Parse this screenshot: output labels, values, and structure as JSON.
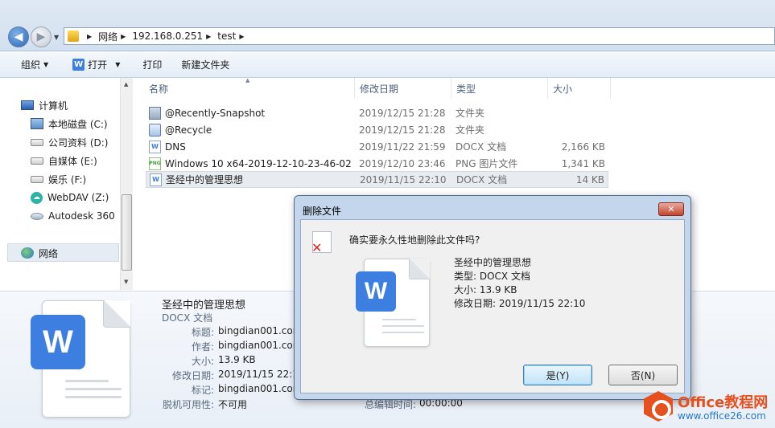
{
  "address": {
    "segments": [
      "网络",
      "192.168.0.251",
      "test"
    ]
  },
  "toolbar": {
    "organize": "组织",
    "open": "打开",
    "print": "打印",
    "new_folder": "新建文件夹"
  },
  "nav": {
    "computer": "计算机",
    "drives": [
      {
        "label": "本地磁盘 (C:)",
        "icon": "system-drive-icon"
      },
      {
        "label": "公司资料 (D:)",
        "icon": "drive-icon"
      },
      {
        "label": "自媒体 (E:)",
        "icon": "drive-icon"
      },
      {
        "label": "娱乐 (F:)",
        "icon": "drive-icon"
      },
      {
        "label": "WebDAV (Z:)",
        "icon": "webdav-icon"
      },
      {
        "label": "Autodesk 360",
        "icon": "cloud-icon"
      }
    ],
    "network": "网络"
  },
  "columns": {
    "name": "名称",
    "date": "修改日期",
    "type": "类型",
    "size": "大小"
  },
  "files": [
    {
      "name": "@Recently-Snapshot",
      "date": "2019/12/15 21:28",
      "type": "文件夹",
      "size": "",
      "icon": "snapshot-folder-icon"
    },
    {
      "name": "@Recycle",
      "date": "2019/12/15 21:28",
      "type": "文件夹",
      "size": "",
      "icon": "recycle-folder-icon"
    },
    {
      "name": "DNS",
      "date": "2019/11/22 21:59",
      "type": "DOCX 文档",
      "size": "2,166 KB",
      "icon": "docx-icon"
    },
    {
      "name": "Windows 10 x64-2019-12-10-23-46-02",
      "date": "2019/12/10 23:46",
      "type": "PNG 图片文件",
      "size": "1,341 KB",
      "icon": "png-icon"
    },
    {
      "name": "圣经中的管理思想",
      "date": "2019/11/15 22:10",
      "type": "DOCX 文档",
      "size": "14 KB",
      "icon": "docx-icon"
    }
  ],
  "details": {
    "filename": "圣经中的管理思想",
    "filetype": "DOCX 文档",
    "title_label": "标题:",
    "title_value": "bingdian001.com",
    "author_label": "作者:",
    "author_value": "bingdian001.com",
    "size_label": "大小:",
    "size_value": "13.9 KB",
    "modified_label": "修改日期:",
    "modified_value": "2019/11/15 22:10",
    "tags_label": "标记:",
    "tags_value": "bingdian001.com",
    "offline_label": "脱机可用性:",
    "offline_value": "不可用",
    "edit_time_label": "总编辑时间:",
    "edit_time_value": "00:00:00"
  },
  "dialog": {
    "title": "删除文件",
    "question": "确实要永久性地删除此文件吗?",
    "file_name": "圣经中的管理思想",
    "file_type": "类型: DOCX 文档",
    "file_size": "大小: 13.9 KB",
    "file_date": "修改日期: 2019/11/15 22:10",
    "yes": "是(Y)",
    "no": "否(N)",
    "close": "✕"
  },
  "watermark": {
    "name": "Office教程网",
    "url": "www.office26.com"
  },
  "colors": {
    "wps_blue": "#3d7fe0",
    "dialog_frame": "#c3d6ec",
    "watermark_orange": "#e6501e"
  }
}
